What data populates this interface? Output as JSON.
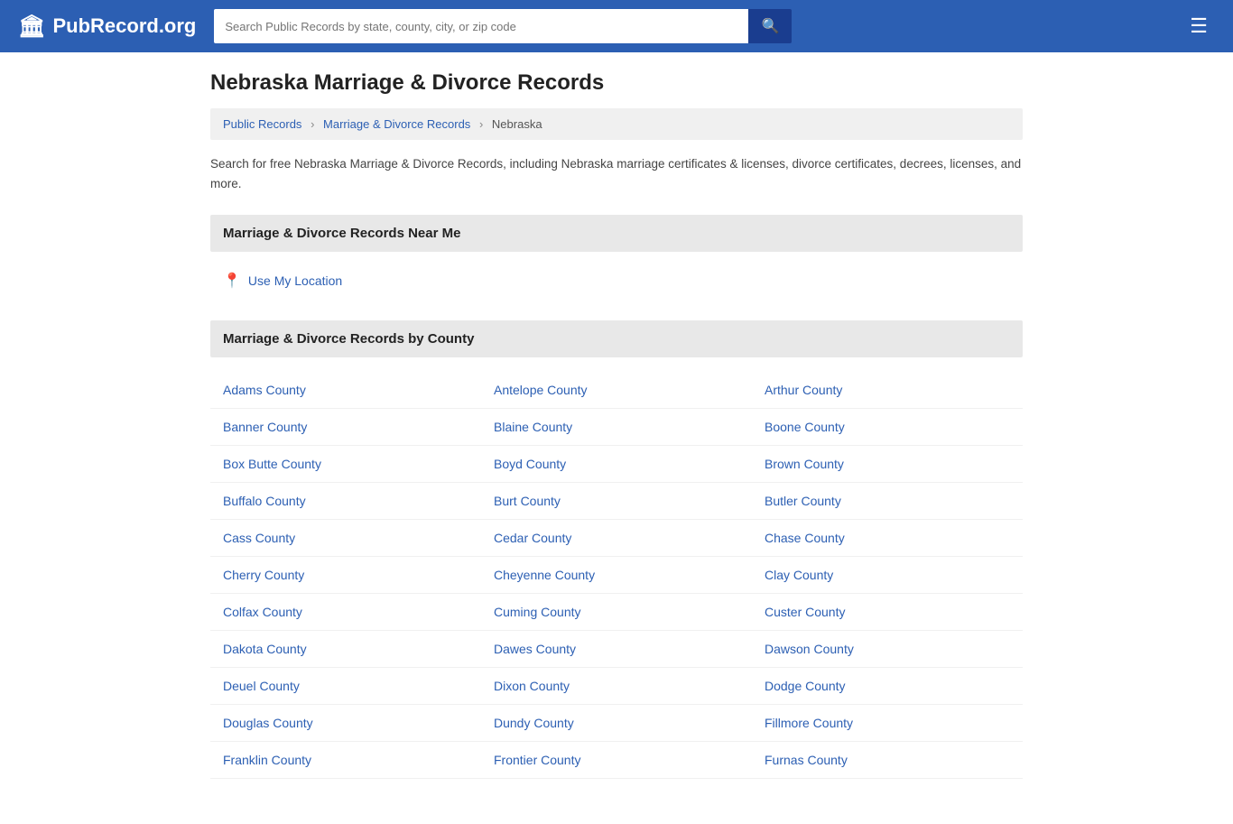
{
  "header": {
    "logo_icon": "🏛",
    "logo_text": "PubRecord.org",
    "search_placeholder": "Search Public Records by state, county, city, or zip code",
    "search_button_icon": "🔍",
    "menu_icon": "☰"
  },
  "breadcrumb": {
    "items": [
      {
        "label": "Public Records",
        "href": "#"
      },
      {
        "label": "Marriage & Divorce Records",
        "href": "#"
      },
      {
        "label": "Nebraska",
        "href": "#"
      }
    ]
  },
  "page": {
    "title": "Nebraska Marriage & Divorce Records",
    "description": "Search for free Nebraska Marriage & Divorce Records, including Nebraska marriage certificates & licenses, divorce certificates, decrees, licenses, and more."
  },
  "near_me": {
    "section_title": "Marriage & Divorce Records Near Me",
    "use_location_label": "Use My Location",
    "pin_icon": "📍"
  },
  "by_county": {
    "section_title": "Marriage & Divorce Records by County",
    "counties": [
      {
        "name": "Adams County",
        "href": "#"
      },
      {
        "name": "Antelope County",
        "href": "#"
      },
      {
        "name": "Arthur County",
        "href": "#"
      },
      {
        "name": "Banner County",
        "href": "#"
      },
      {
        "name": "Blaine County",
        "href": "#"
      },
      {
        "name": "Boone County",
        "href": "#"
      },
      {
        "name": "Box Butte County",
        "href": "#"
      },
      {
        "name": "Boyd County",
        "href": "#"
      },
      {
        "name": "Brown County",
        "href": "#"
      },
      {
        "name": "Buffalo County",
        "href": "#"
      },
      {
        "name": "Burt County",
        "href": "#"
      },
      {
        "name": "Butler County",
        "href": "#"
      },
      {
        "name": "Cass County",
        "href": "#"
      },
      {
        "name": "Cedar County",
        "href": "#"
      },
      {
        "name": "Chase County",
        "href": "#"
      },
      {
        "name": "Cherry County",
        "href": "#"
      },
      {
        "name": "Cheyenne County",
        "href": "#"
      },
      {
        "name": "Clay County",
        "href": "#"
      },
      {
        "name": "Colfax County",
        "href": "#"
      },
      {
        "name": "Cuming County",
        "href": "#"
      },
      {
        "name": "Custer County",
        "href": "#"
      },
      {
        "name": "Dakota County",
        "href": "#"
      },
      {
        "name": "Dawes County",
        "href": "#"
      },
      {
        "name": "Dawson County",
        "href": "#"
      },
      {
        "name": "Deuel County",
        "href": "#"
      },
      {
        "name": "Dixon County",
        "href": "#"
      },
      {
        "name": "Dodge County",
        "href": "#"
      },
      {
        "name": "Douglas County",
        "href": "#"
      },
      {
        "name": "Dundy County",
        "href": "#"
      },
      {
        "name": "Fillmore County",
        "href": "#"
      },
      {
        "name": "Franklin County",
        "href": "#"
      },
      {
        "name": "Frontier County",
        "href": "#"
      },
      {
        "name": "Furnas County",
        "href": "#"
      }
    ]
  }
}
